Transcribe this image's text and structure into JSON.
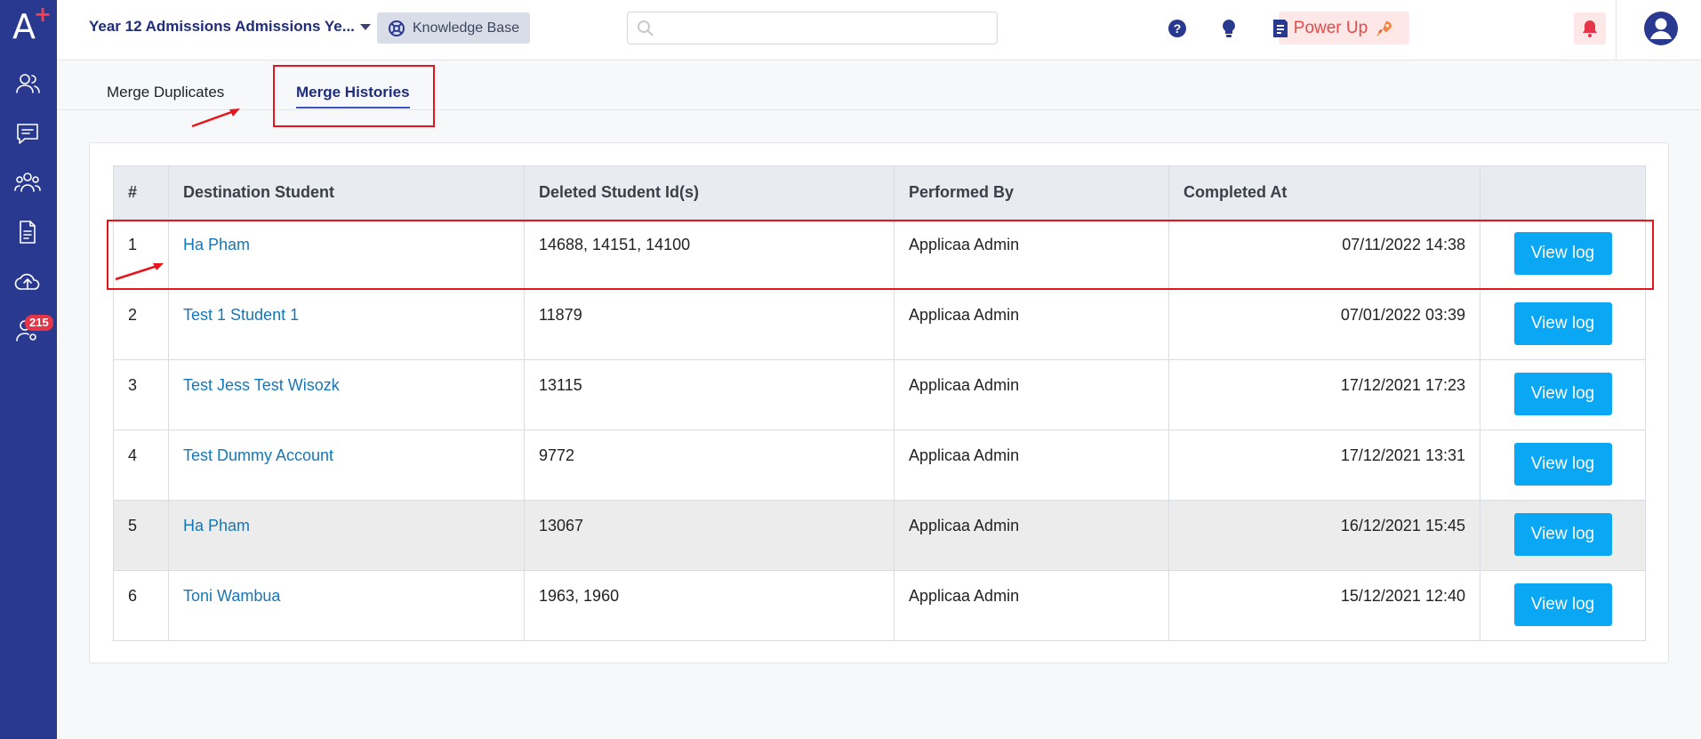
{
  "app": {
    "logo_text": "A",
    "logo_plus": "+"
  },
  "sidebar": {
    "items": [
      {
        "icon": "contacts-icon"
      },
      {
        "icon": "messages-icon"
      },
      {
        "icon": "users-icon"
      },
      {
        "icon": "document-icon"
      },
      {
        "icon": "cloud-upload-icon"
      },
      {
        "icon": "user-settings-icon",
        "badge": "215"
      }
    ]
  },
  "header": {
    "workspace": "Year 12 Admissions Admissions Ye...",
    "knowledge_base": "Knowledge Base",
    "search_placeholder": "",
    "power_up": "Power Up",
    "colors": {
      "brand": "#2a3990",
      "accent": "#0aa7f5",
      "highlight": "#e8141c"
    }
  },
  "tabs": [
    {
      "label": "Merge Duplicates",
      "active": false
    },
    {
      "label": "Merge Histories",
      "active": true
    }
  ],
  "table": {
    "columns": [
      "#",
      "Destination Student",
      "Deleted Student Id(s)",
      "Performed By",
      "Completed At",
      ""
    ],
    "rows": [
      {
        "num": "1",
        "student": "Ha Pham",
        "deleted": "14688, 14151, 14100",
        "by": "Applicaa Admin",
        "completed": "07/11/2022 14:38",
        "action": "View log"
      },
      {
        "num": "2",
        "student": "Test 1 Student 1",
        "deleted": "11879",
        "by": "Applicaa Admin",
        "completed": "07/01/2022 03:39",
        "action": "View log"
      },
      {
        "num": "3",
        "student": "Test Jess Test Wisozk",
        "deleted": "13115",
        "by": "Applicaa Admin",
        "completed": "17/12/2021 17:23",
        "action": "View log"
      },
      {
        "num": "4",
        "student": "Test Dummy Account",
        "deleted": "9772",
        "by": "Applicaa Admin",
        "completed": "17/12/2021 13:31",
        "action": "View log"
      },
      {
        "num": "5",
        "student": "Ha Pham",
        "deleted": "13067",
        "by": "Applicaa Admin",
        "completed": "16/12/2021 15:45",
        "action": "View log"
      },
      {
        "num": "6",
        "student": "Toni Wambua",
        "deleted": "1963, 1960",
        "by": "Applicaa Admin",
        "completed": "15/12/2021 12:40",
        "action": "View log"
      }
    ]
  }
}
